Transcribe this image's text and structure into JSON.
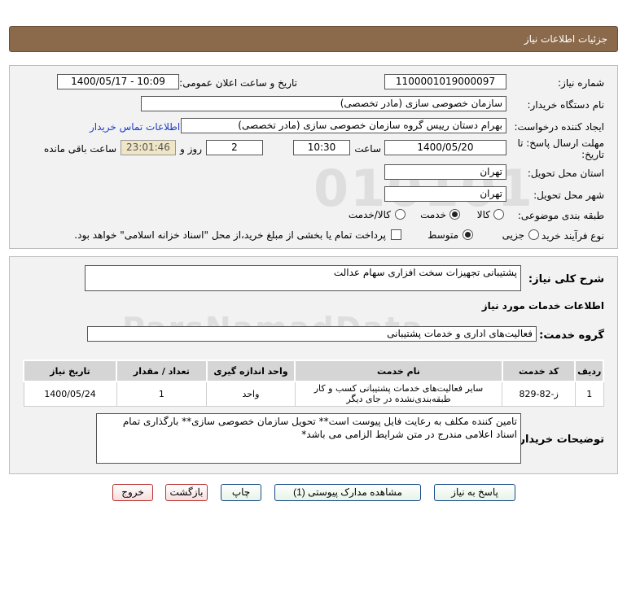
{
  "header": {
    "title": "جزئیات اطلاعات نیاز"
  },
  "form": {
    "need_number_label": "شماره نیاز:",
    "need_number": "1100001019000097",
    "announce_label": "تاریخ و ساعت اعلان عمومی:",
    "announce_value": "1400/05/17 - 10:09",
    "buyer_org_label": "نام دستگاه خریدار:",
    "buyer_org": "سازمان خصوصی سازی (مادر تخصصی)",
    "creator_label": "ایجاد کننده درخواست:",
    "creator": "بهرام دستان رییس گروه سازمان خصوصی سازی (مادر تخصصی)",
    "contact_link": "اطلاعات تماس خریدار",
    "deadline_label_1": "مهلت ارسال پاسخ: تا",
    "deadline_label_2": "تاریخ:",
    "deadline_date": "1400/05/20",
    "time_label": "ساعت",
    "deadline_time": "10:30",
    "days_value": "2",
    "days_label": "روز و",
    "remaining_time": "23:01:46",
    "remaining_label": "ساعت باقی مانده",
    "province_label": "استان محل تحویل:",
    "province": "تهران",
    "city_label": "شهر محل تحویل:",
    "city": "تهران",
    "category_label": "طبقه بندی موضوعی:",
    "category_options": [
      "کالا",
      "خدمت",
      "کالا/خدمت"
    ],
    "process_label": "نوع فرآیند خرید :",
    "process_options": [
      "جزیی",
      "متوسط"
    ],
    "payment_note": "پرداخت تمام یا بخشی از مبلغ خرید،از محل \"اسناد خزانه اسلامی\" خواهد بود."
  },
  "description": {
    "summary_label": "شرح کلی نیاز:",
    "summary": "پشتیبانی تجهیزات سخت افزاری سهام عدالت",
    "services_title": "اطلاعات خدمات مورد نیاز",
    "service_group_label": "گروه خدمت:",
    "service_group": "فعالیت‌های اداری و خدمات پشتیبانی"
  },
  "table": {
    "headers": [
      "ردیف",
      "کد خدمت",
      "نام خدمت",
      "واحد اندازه گیری",
      "تعداد / مقدار",
      "تاریخ نیاز"
    ],
    "rows": [
      {
        "row": "1",
        "code": "ز-82-829",
        "name_line1": "سایر فعالیت‌های خدمات پشتیبانی کسب و کار",
        "name_line2": "طبقه‌بندی‌نشده در جای دیگر",
        "unit": "واحد",
        "qty": "1",
        "date": "1400/05/24"
      }
    ]
  },
  "buyer_notes": {
    "label": "توضیحات خریدار:",
    "text": "تامین کننده مکلف به رعایت فایل پیوست است** تحویل سازمان خصوصی سازی** بارگذاری تمام اسناد اعلامی مندرج در متن شرایط الزامی می باشد*"
  },
  "buttons": {
    "reply": "پاسخ به نیاز",
    "attachments": "مشاهده مدارک پیوستی (1)",
    "print": "چاپ",
    "back": "بازگشت",
    "exit": "خروج"
  }
}
